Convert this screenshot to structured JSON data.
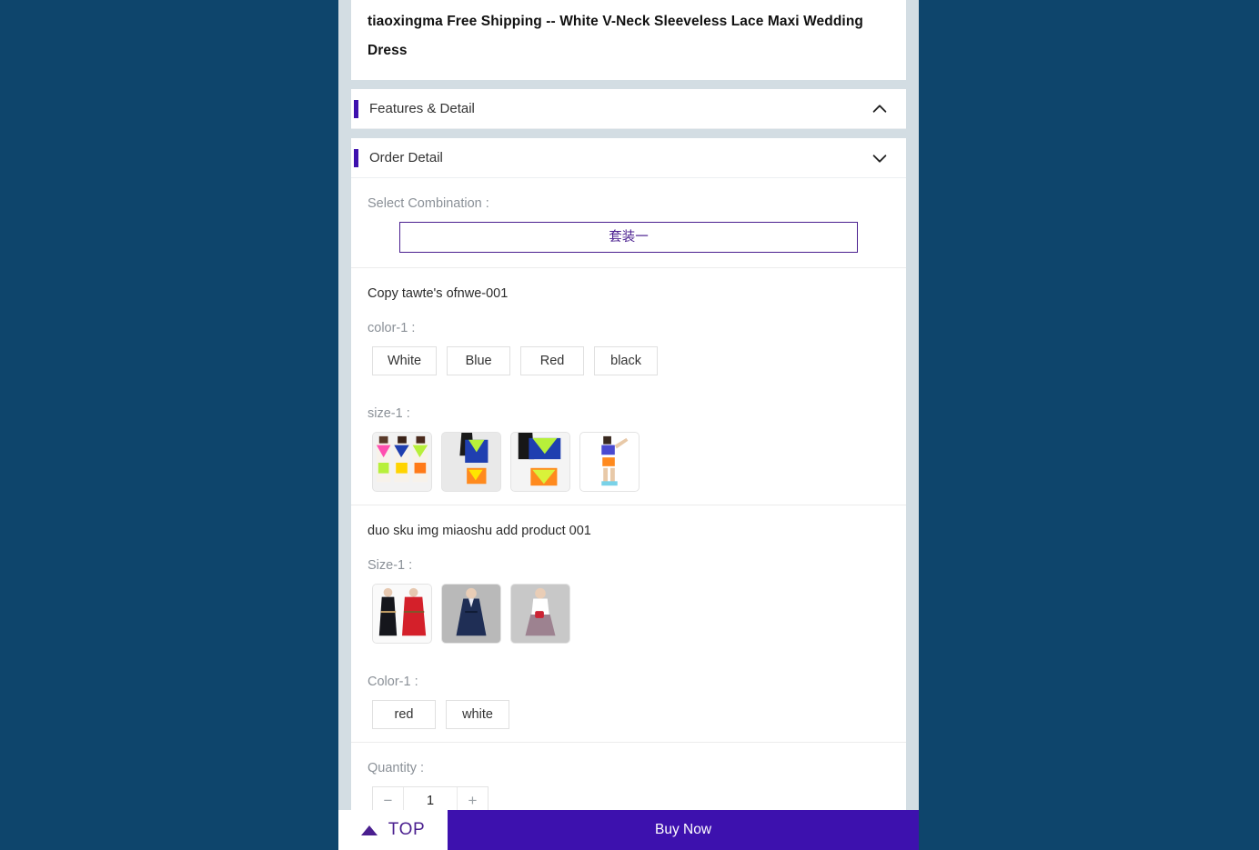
{
  "product": {
    "title": "tiaoxingma Free Shipping -- White V-Neck Sleeveless Lace Maxi Wedding Dress"
  },
  "sections": [
    {
      "title": "Features & Detail",
      "chevron": "chevron-up-icon"
    },
    {
      "title": "Order Detail",
      "chevron": "chevron-down-icon"
    }
  ],
  "order_detail": {
    "combination": {
      "label": "Select Combination :",
      "selected": "套装一",
      "accent": "#4a1f8f"
    },
    "sku_groups": [
      {
        "name": "Copy tawte's ofnwe-001",
        "options": [
          {
            "label": "color-1 :",
            "type": "text",
            "values": [
              "White",
              "Blue",
              "Red",
              "black"
            ]
          },
          {
            "label": "size-1 :",
            "type": "image",
            "values": [
              "swimwear-trio-thumb",
              "swimwear-side-thumb",
              "swimwear-front-thumb",
              "swimwear-full-thumb"
            ]
          }
        ]
      },
      {
        "name": "duo sku img miaoshu add product 001",
        "options": [
          {
            "label": "Size-1 :",
            "type": "image",
            "values": [
              "dress-black-red-thumb",
              "dress-navy-thumb",
              "dress-skirt-thumb"
            ]
          },
          {
            "label": "Color-1 :",
            "type": "text",
            "values": [
              "red",
              "white"
            ]
          }
        ]
      }
    ],
    "quantity": {
      "label": "Quantity :",
      "value": "1",
      "minus": "−",
      "plus": "+"
    }
  },
  "bottom_bar": {
    "top_label": "TOP",
    "top_icon": "triangle-up-icon",
    "buy_now_label": "Buy Now",
    "buy_now_color": "#3d11ae"
  },
  "theme": {
    "page_background": "#0e456c",
    "frame_background": "#d3dde3",
    "accent": "#3d11ae"
  }
}
